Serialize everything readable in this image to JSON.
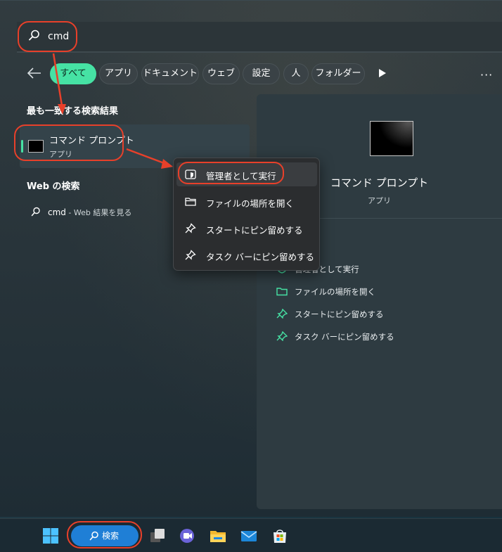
{
  "search": {
    "query": "cmd"
  },
  "filters": {
    "chips": [
      {
        "label": "すべて",
        "active": true
      },
      {
        "label": "アプリ",
        "active": false
      },
      {
        "label": "ドキュメント",
        "active": false
      },
      {
        "label": "ウェブ",
        "active": false
      },
      {
        "label": "設定",
        "active": false
      },
      {
        "label": "人",
        "active": false
      },
      {
        "label": "フォルダー",
        "active": false
      }
    ],
    "more_glyph": "···"
  },
  "results": {
    "best_match_title": "最も一致する検索結果",
    "best_match": {
      "title": "コマンド プロンプト",
      "subtitle": "アプリ"
    },
    "web_title": "Web の検索",
    "web_item": {
      "query": "cmd",
      "suffix": " - Web 結果を見る"
    }
  },
  "context_menu": {
    "items": [
      {
        "label": "管理者として実行",
        "icon": "shield-icon"
      },
      {
        "label": "ファイルの場所を開く",
        "icon": "folder-icon"
      },
      {
        "label": "スタートにピン留めする",
        "icon": "pin-icon"
      },
      {
        "label": "タスク バーにピン留めする",
        "icon": "pin-icon"
      }
    ]
  },
  "detail": {
    "title": "コマンド プロンプト",
    "subtitle": "アプリ",
    "actions": [
      {
        "label": "管理者として実行",
        "icon": "shield-icon"
      },
      {
        "label": "ファイルの場所を開く",
        "icon": "folder-icon"
      },
      {
        "label": "スタートにピン留めする",
        "icon": "pin-icon"
      },
      {
        "label": "タスク バーにピン留めする",
        "icon": "pin-icon"
      }
    ]
  },
  "taskbar": {
    "search_label": "検索"
  },
  "colors": {
    "accent": "#46e2a4",
    "annotation": "#e8402a",
    "taskbar_search": "#1f7fd6"
  }
}
